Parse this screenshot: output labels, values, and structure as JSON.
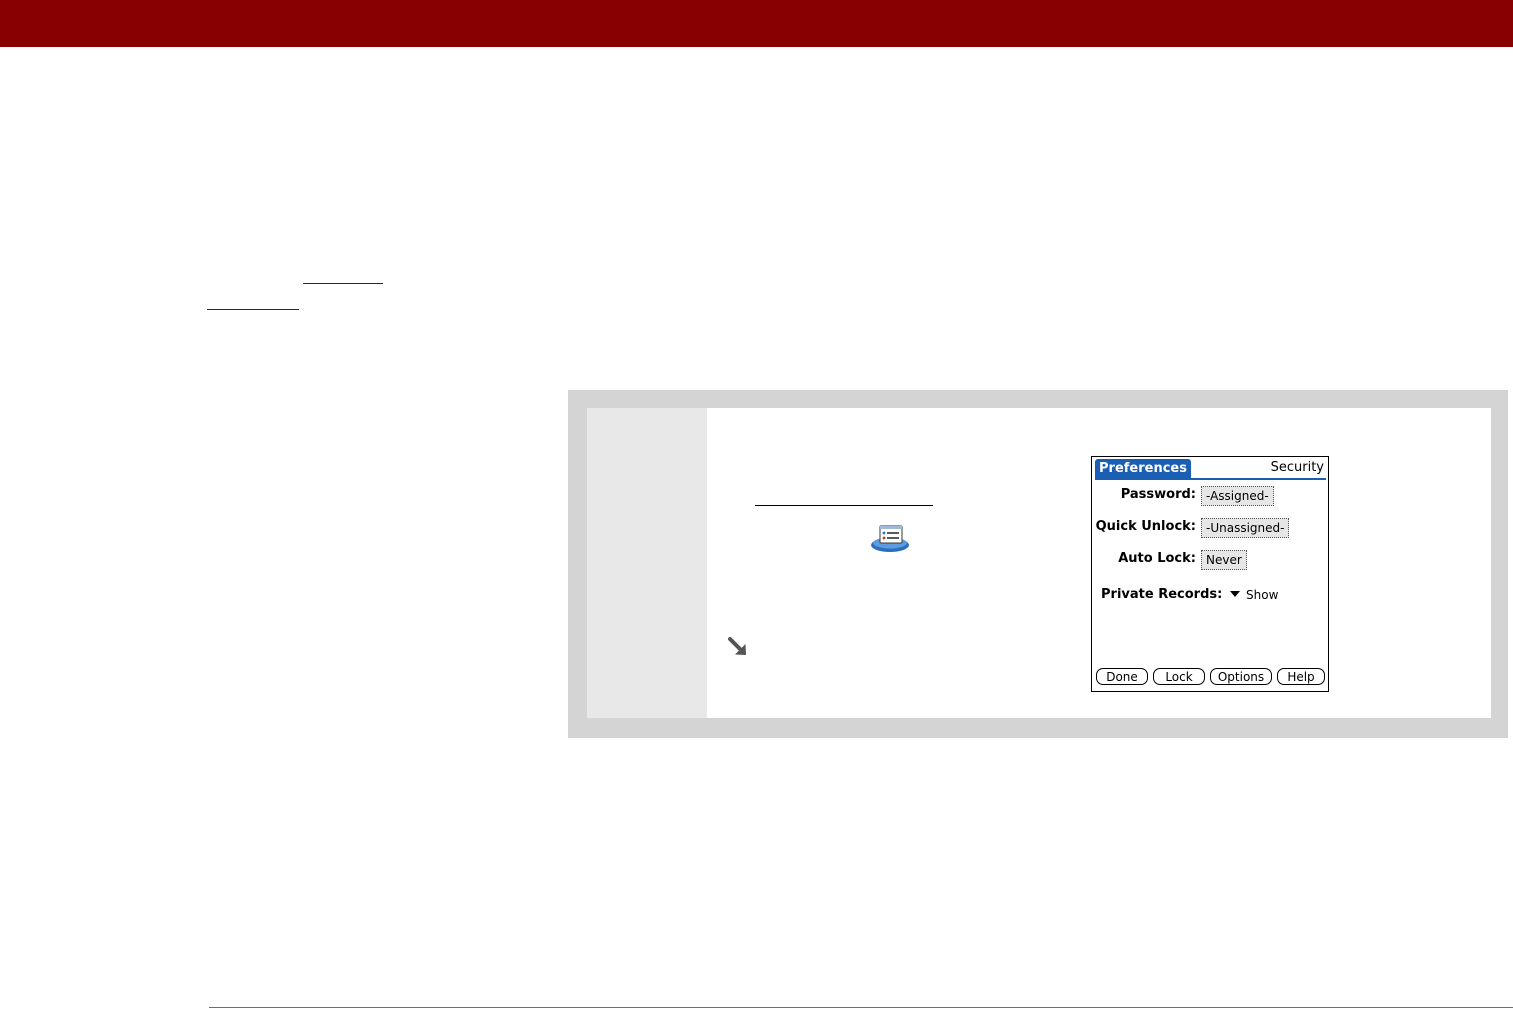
{
  "palm": {
    "title": "Preferences",
    "category": "Security",
    "password_label": "Password:",
    "password_value": "-Assigned-",
    "quick_unlock_label": "Quick Unlock:",
    "quick_unlock_value": "-Unassigned-",
    "auto_lock_label": "Auto Lock:",
    "auto_lock_value": "Never",
    "private_records_label": "Private Records:",
    "private_records_value": "Show",
    "buttons": {
      "done": "Done",
      "lock": "Lock",
      "options": "Options",
      "help": "Help"
    },
    "accent_color": "#1a5fb4"
  },
  "colors": {
    "header": "#880000",
    "step_frame": "#d4d4d4",
    "step_number_column": "#e8e8e8"
  },
  "icons": {
    "app": "preferences-app-icon",
    "tip": "tip-arrow-icon"
  }
}
